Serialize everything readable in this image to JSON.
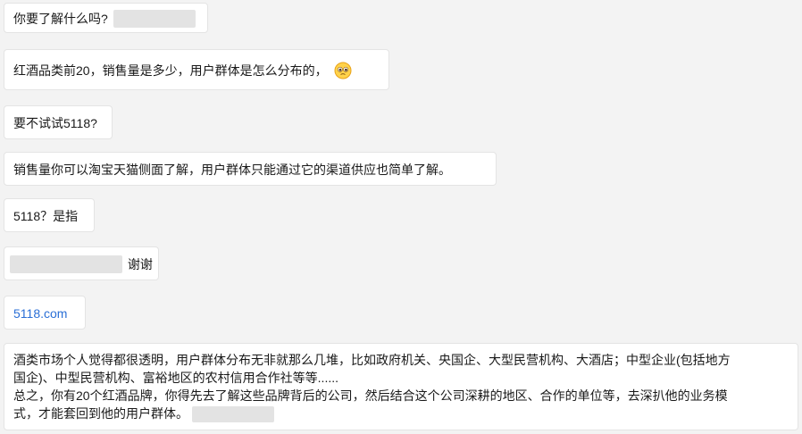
{
  "messages": [
    {
      "text": "你要了解什么吗?"
    },
    {
      "text": "红酒品类前20，销售量是多少，用户群体是怎么分布的，",
      "emoji": "pleading-face-icon"
    },
    {
      "text": "要不试试5118?"
    },
    {
      "text": "销售量你可以淘宝天猫侧面了解，用户群体只能通过它的渠道供应也简单了解。"
    },
    {
      "text": "5118？是指"
    },
    {
      "text": "谢谢"
    },
    {
      "text": "5118.com"
    },
    {
      "line1": "酒类市场个人觉得都很透明，用户群体分布无非就那么几堆，比如政府机关、央国企、大型民营机构、大酒店；中型企业(包括地方",
      "line2": "国企)、中型民营机构、富裕地区的农村信用合作社等等......",
      "line3": "总之，你有20个红酒品牌，你得先去了解这些品牌背后的公司，然后结合这个公司深耕的地区、合作的单位等，去深扒他的业务模",
      "line4": "式，才能套回到他的用户群体。"
    }
  ],
  "colors": {
    "background": "#f3f3f3",
    "bubble": "#ffffff",
    "link": "#2b6fd6",
    "redaction": "#e3e3e3"
  }
}
